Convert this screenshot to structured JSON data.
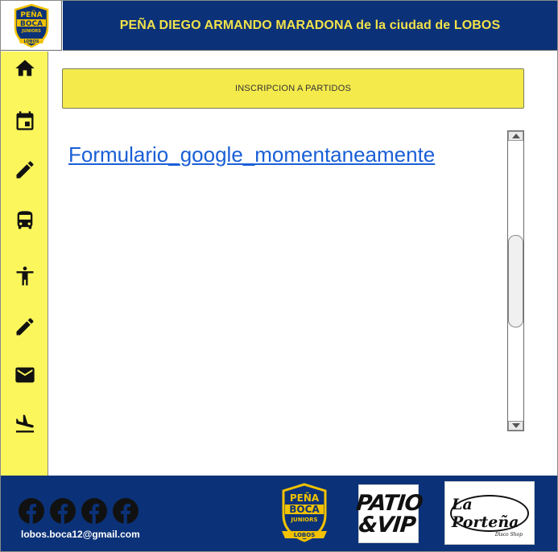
{
  "header": {
    "title": "PEÑA DIEGO ARMANDO MARADONA de la ciudad de LOBOS",
    "crest": {
      "line1": "PEÑA",
      "line2": "BOCA",
      "line3": "JUNIORS",
      "ribbon": "LOBOS"
    }
  },
  "sidebar": {
    "items": [
      {
        "icon": "home-icon"
      },
      {
        "icon": "calendar-icon"
      },
      {
        "icon": "pencil-icon"
      },
      {
        "icon": "bus-icon"
      },
      {
        "icon": "accessibility-icon"
      },
      {
        "icon": "pencil-icon"
      },
      {
        "icon": "mail-icon"
      },
      {
        "icon": "flight-land-icon"
      }
    ]
  },
  "main": {
    "section_title": "INSCRIPCION A PARTIDOS",
    "link_text": "Formulario_google_momentaneamente"
  },
  "footer": {
    "email": "lobos.boca12@gmail.com",
    "social": [
      "facebook-icon",
      "facebook-icon",
      "facebook-icon",
      "facebook-icon"
    ],
    "sponsors": {
      "patio_line1": "PATIO",
      "patio_line2": "&VIP",
      "portena": "La Porteña",
      "portena_sub": "Disco Shop"
    }
  },
  "colors": {
    "navy": "#0b3278",
    "yellow_title": "#f2e24a",
    "sidebar_yellow": "#fbf65c",
    "section_yellow": "#f4ea4c",
    "link_blue": "#1a5fd6"
  }
}
